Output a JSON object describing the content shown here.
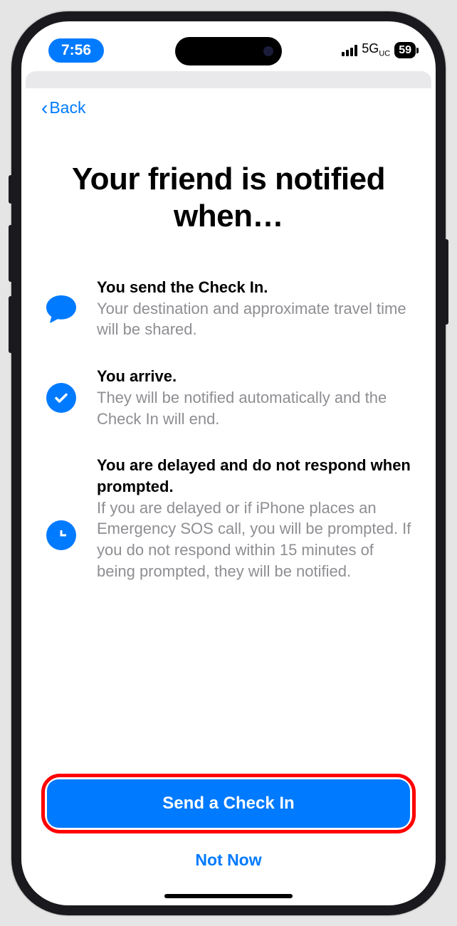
{
  "status": {
    "time": "7:56",
    "network": "5G",
    "network_sub": "UC",
    "battery": "59"
  },
  "nav": {
    "back_label": "Back"
  },
  "title": "Your friend is notified when…",
  "items": [
    {
      "title": "You send the Check In.",
      "desc": "Your destination and approximate travel time will be shared."
    },
    {
      "title": "You arrive.",
      "desc": "They will be notified automatically and the Check In will end."
    },
    {
      "title": "You are delayed and do not respond when prompted.",
      "desc": "If you are delayed or if iPhone places an Emergency SOS call, you will be prompted. If you do not respond within 15 minutes of being prompted, they will be notified."
    }
  ],
  "footer": {
    "primary": "Send a Check In",
    "secondary": "Not Now"
  }
}
